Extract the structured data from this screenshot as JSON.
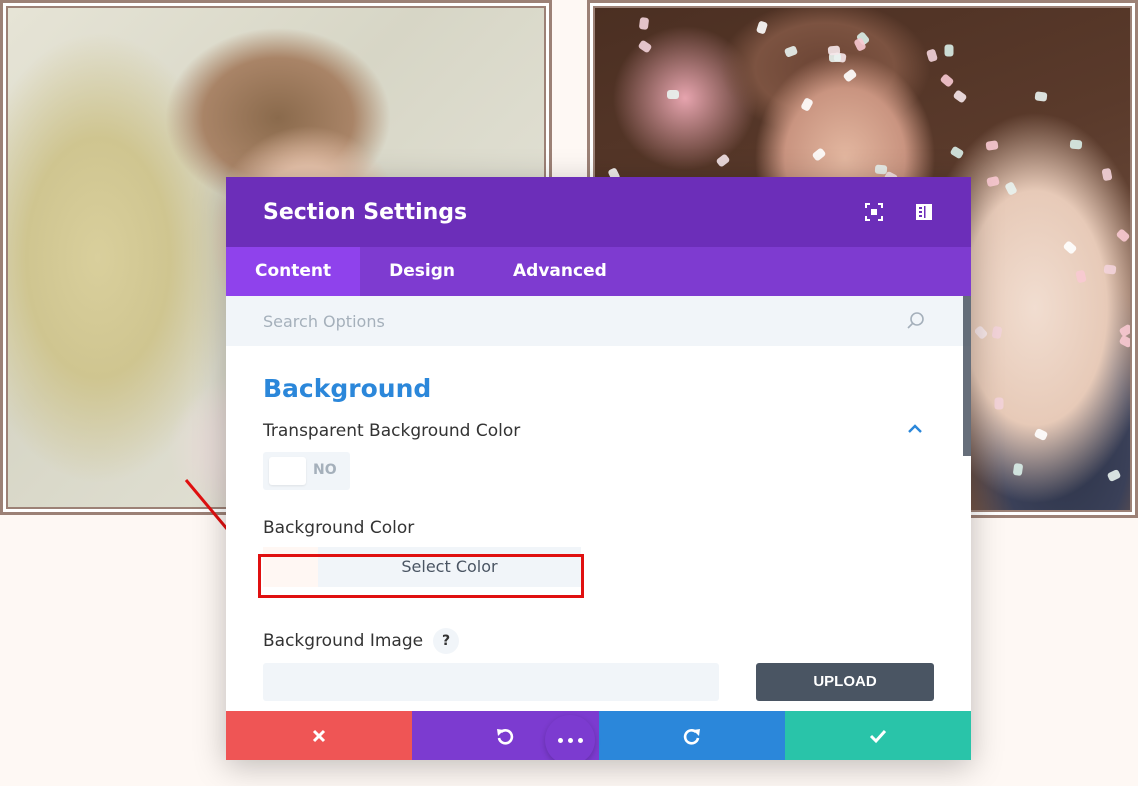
{
  "modal": {
    "title": "Section Settings",
    "tabs": [
      {
        "label": "Content",
        "active": true
      },
      {
        "label": "Design",
        "active": false
      },
      {
        "label": "Advanced",
        "active": false
      }
    ],
    "search": {
      "placeholder": "Search Options"
    }
  },
  "background_section": {
    "title": "Background",
    "transparent": {
      "label": "Transparent Background Color",
      "toggle_text": "NO"
    },
    "color": {
      "label": "Background Color",
      "button_label": "Select Color"
    },
    "image": {
      "label": "Background Image",
      "help": "?",
      "upload_label": "UPLOAD"
    }
  },
  "colors": {
    "header": "#6c2eb9",
    "tabs": "#7e3bd0",
    "accent_blue": "#2b87da",
    "close": "#ef5555",
    "save": "#29c4a9",
    "annotation": "#e01010"
  },
  "icons": [
    "expand-icon",
    "sidebar-toggle-icon",
    "search-icon",
    "chevron-up-icon",
    "close-icon",
    "undo-icon",
    "redo-icon",
    "check-icon",
    "more-icon"
  ]
}
